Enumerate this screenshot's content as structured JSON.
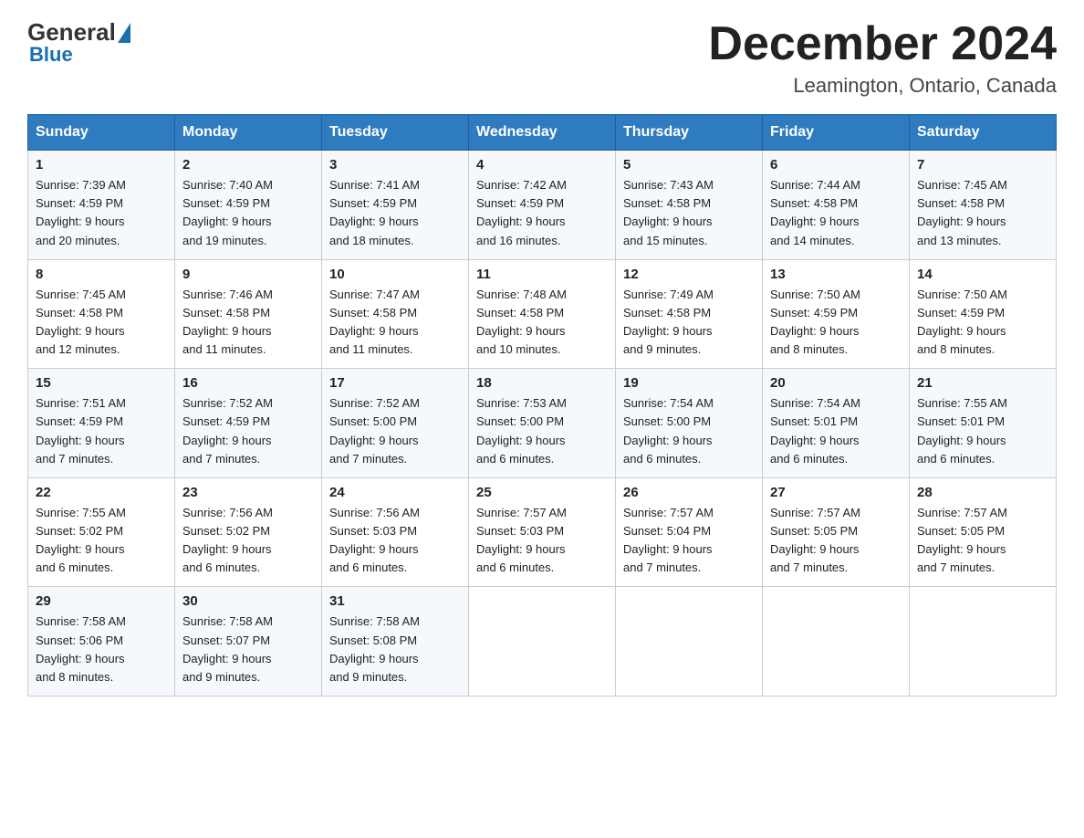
{
  "header": {
    "logo_general": "General",
    "logo_blue": "Blue",
    "month_title": "December 2024",
    "location": "Leamington, Ontario, Canada"
  },
  "days_of_week": [
    "Sunday",
    "Monday",
    "Tuesday",
    "Wednesday",
    "Thursday",
    "Friday",
    "Saturday"
  ],
  "weeks": [
    [
      {
        "num": "1",
        "sunrise": "7:39 AM",
        "sunset": "4:59 PM",
        "daylight": "9 hours and 20 minutes."
      },
      {
        "num": "2",
        "sunrise": "7:40 AM",
        "sunset": "4:59 PM",
        "daylight": "9 hours and 19 minutes."
      },
      {
        "num": "3",
        "sunrise": "7:41 AM",
        "sunset": "4:59 PM",
        "daylight": "9 hours and 18 minutes."
      },
      {
        "num": "4",
        "sunrise": "7:42 AM",
        "sunset": "4:59 PM",
        "daylight": "9 hours and 16 minutes."
      },
      {
        "num": "5",
        "sunrise": "7:43 AM",
        "sunset": "4:58 PM",
        "daylight": "9 hours and 15 minutes."
      },
      {
        "num": "6",
        "sunrise": "7:44 AM",
        "sunset": "4:58 PM",
        "daylight": "9 hours and 14 minutes."
      },
      {
        "num": "7",
        "sunrise": "7:45 AM",
        "sunset": "4:58 PM",
        "daylight": "9 hours and 13 minutes."
      }
    ],
    [
      {
        "num": "8",
        "sunrise": "7:45 AM",
        "sunset": "4:58 PM",
        "daylight": "9 hours and 12 minutes."
      },
      {
        "num": "9",
        "sunrise": "7:46 AM",
        "sunset": "4:58 PM",
        "daylight": "9 hours and 11 minutes."
      },
      {
        "num": "10",
        "sunrise": "7:47 AM",
        "sunset": "4:58 PM",
        "daylight": "9 hours and 11 minutes."
      },
      {
        "num": "11",
        "sunrise": "7:48 AM",
        "sunset": "4:58 PM",
        "daylight": "9 hours and 10 minutes."
      },
      {
        "num": "12",
        "sunrise": "7:49 AM",
        "sunset": "4:58 PM",
        "daylight": "9 hours and 9 minutes."
      },
      {
        "num": "13",
        "sunrise": "7:50 AM",
        "sunset": "4:59 PM",
        "daylight": "9 hours and 8 minutes."
      },
      {
        "num": "14",
        "sunrise": "7:50 AM",
        "sunset": "4:59 PM",
        "daylight": "9 hours and 8 minutes."
      }
    ],
    [
      {
        "num": "15",
        "sunrise": "7:51 AM",
        "sunset": "4:59 PM",
        "daylight": "9 hours and 7 minutes."
      },
      {
        "num": "16",
        "sunrise": "7:52 AM",
        "sunset": "4:59 PM",
        "daylight": "9 hours and 7 minutes."
      },
      {
        "num": "17",
        "sunrise": "7:52 AM",
        "sunset": "5:00 PM",
        "daylight": "9 hours and 7 minutes."
      },
      {
        "num": "18",
        "sunrise": "7:53 AM",
        "sunset": "5:00 PM",
        "daylight": "9 hours and 6 minutes."
      },
      {
        "num": "19",
        "sunrise": "7:54 AM",
        "sunset": "5:00 PM",
        "daylight": "9 hours and 6 minutes."
      },
      {
        "num": "20",
        "sunrise": "7:54 AM",
        "sunset": "5:01 PM",
        "daylight": "9 hours and 6 minutes."
      },
      {
        "num": "21",
        "sunrise": "7:55 AM",
        "sunset": "5:01 PM",
        "daylight": "9 hours and 6 minutes."
      }
    ],
    [
      {
        "num": "22",
        "sunrise": "7:55 AM",
        "sunset": "5:02 PM",
        "daylight": "9 hours and 6 minutes."
      },
      {
        "num": "23",
        "sunrise": "7:56 AM",
        "sunset": "5:02 PM",
        "daylight": "9 hours and 6 minutes."
      },
      {
        "num": "24",
        "sunrise": "7:56 AM",
        "sunset": "5:03 PM",
        "daylight": "9 hours and 6 minutes."
      },
      {
        "num": "25",
        "sunrise": "7:57 AM",
        "sunset": "5:03 PM",
        "daylight": "9 hours and 6 minutes."
      },
      {
        "num": "26",
        "sunrise": "7:57 AM",
        "sunset": "5:04 PM",
        "daylight": "9 hours and 7 minutes."
      },
      {
        "num": "27",
        "sunrise": "7:57 AM",
        "sunset": "5:05 PM",
        "daylight": "9 hours and 7 minutes."
      },
      {
        "num": "28",
        "sunrise": "7:57 AM",
        "sunset": "5:05 PM",
        "daylight": "9 hours and 7 minutes."
      }
    ],
    [
      {
        "num": "29",
        "sunrise": "7:58 AM",
        "sunset": "5:06 PM",
        "daylight": "9 hours and 8 minutes."
      },
      {
        "num": "30",
        "sunrise": "7:58 AM",
        "sunset": "5:07 PM",
        "daylight": "9 hours and 9 minutes."
      },
      {
        "num": "31",
        "sunrise": "7:58 AM",
        "sunset": "5:08 PM",
        "daylight": "9 hours and 9 minutes."
      },
      null,
      null,
      null,
      null
    ]
  ]
}
